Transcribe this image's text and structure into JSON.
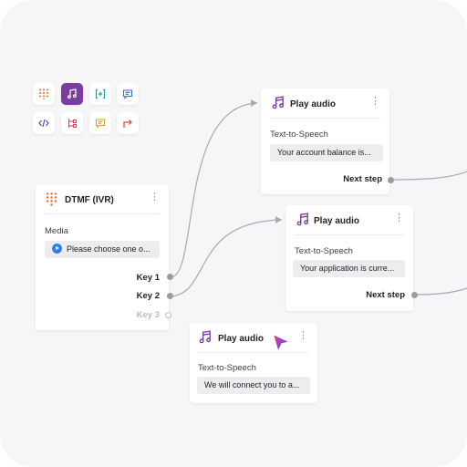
{
  "palette": {
    "tools": [
      {
        "name": "dtmf-keypad-icon",
        "active": false
      },
      {
        "name": "music-note-icon",
        "active": true
      },
      {
        "name": "variable-brackets-icon",
        "active": false
      },
      {
        "name": "message-bubble-icon",
        "active": false
      },
      {
        "name": "code-icon",
        "active": false
      },
      {
        "name": "branch-icon",
        "active": false
      },
      {
        "name": "chat-bubble-icon",
        "active": false
      },
      {
        "name": "redirect-arrow-icon",
        "active": false
      }
    ]
  },
  "dtmf_card": {
    "title": "DTMF (IVR)",
    "media_label": "Media",
    "media_value": "Please choose one o...",
    "keys": [
      "Key 1",
      "Key 2",
      "Key 3"
    ]
  },
  "play_audio_1": {
    "title": "Play audio",
    "section_label": "Text-to-Speech",
    "value": "Your account balance is...",
    "next_label": "Next step"
  },
  "play_audio_2": {
    "title": "Play audio",
    "section_label": "Text-to-Speech",
    "value": "Your application is curre...",
    "next_label": "Next step"
  },
  "play_audio_3": {
    "title": "Play audio",
    "section_label": "Text-to-Speech",
    "value": "We will connect you to a..."
  },
  "colors": {
    "accent": "#7a3f9e",
    "dtmf_orange": "#e8702a",
    "media_blue": "#2f7df6",
    "canvas": "#f6f6f8"
  }
}
